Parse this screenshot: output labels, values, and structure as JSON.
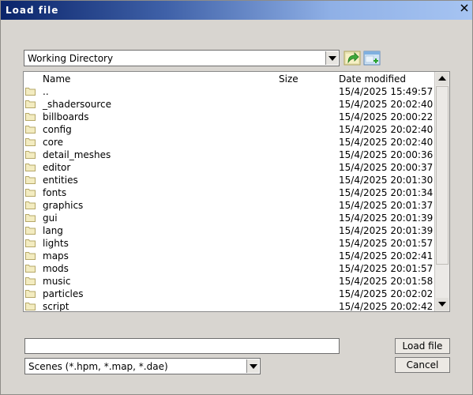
{
  "window": {
    "title": "Load file"
  },
  "location_combo": {
    "value": "Working Directory"
  },
  "toolbar": {
    "up_icon": "folder-up-icon",
    "new_folder_icon": "new-folder-icon"
  },
  "list": {
    "columns": {
      "name": "Name",
      "size": "Size",
      "date": "Date modified"
    },
    "rows": [
      {
        "name": "..",
        "date": "15/4/2025 15:49:57"
      },
      {
        "name": "_shadersource",
        "date": "15/4/2025 20:02:40"
      },
      {
        "name": "billboards",
        "date": "15/4/2025 20:00:22"
      },
      {
        "name": "config",
        "date": "15/4/2025 20:02:40"
      },
      {
        "name": "core",
        "date": "15/4/2025 20:02:40"
      },
      {
        "name": "detail_meshes",
        "date": "15/4/2025 20:00:36"
      },
      {
        "name": "editor",
        "date": "15/4/2025 20:00:37"
      },
      {
        "name": "entities",
        "date": "15/4/2025 20:01:30"
      },
      {
        "name": "fonts",
        "date": "15/4/2025 20:01:34"
      },
      {
        "name": "graphics",
        "date": "15/4/2025 20:01:37"
      },
      {
        "name": "gui",
        "date": "15/4/2025 20:01:39"
      },
      {
        "name": "lang",
        "date": "15/4/2025 20:01:39"
      },
      {
        "name": "lights",
        "date": "15/4/2025 20:01:57"
      },
      {
        "name": "maps",
        "date": "15/4/2025 20:02:41"
      },
      {
        "name": "mods",
        "date": "15/4/2025 20:01:57"
      },
      {
        "name": "music",
        "date": "15/4/2025 20:01:58"
      },
      {
        "name": "particles",
        "date": "15/4/2025 20:02:02"
      },
      {
        "name": "script",
        "date": "15/4/2025 20:02:42"
      }
    ]
  },
  "filename": {
    "value": ""
  },
  "filter_combo": {
    "value": "Scenes (*.hpm, *.map, *.dae)"
  },
  "buttons": {
    "load": "Load file",
    "cancel": "Cancel"
  }
}
